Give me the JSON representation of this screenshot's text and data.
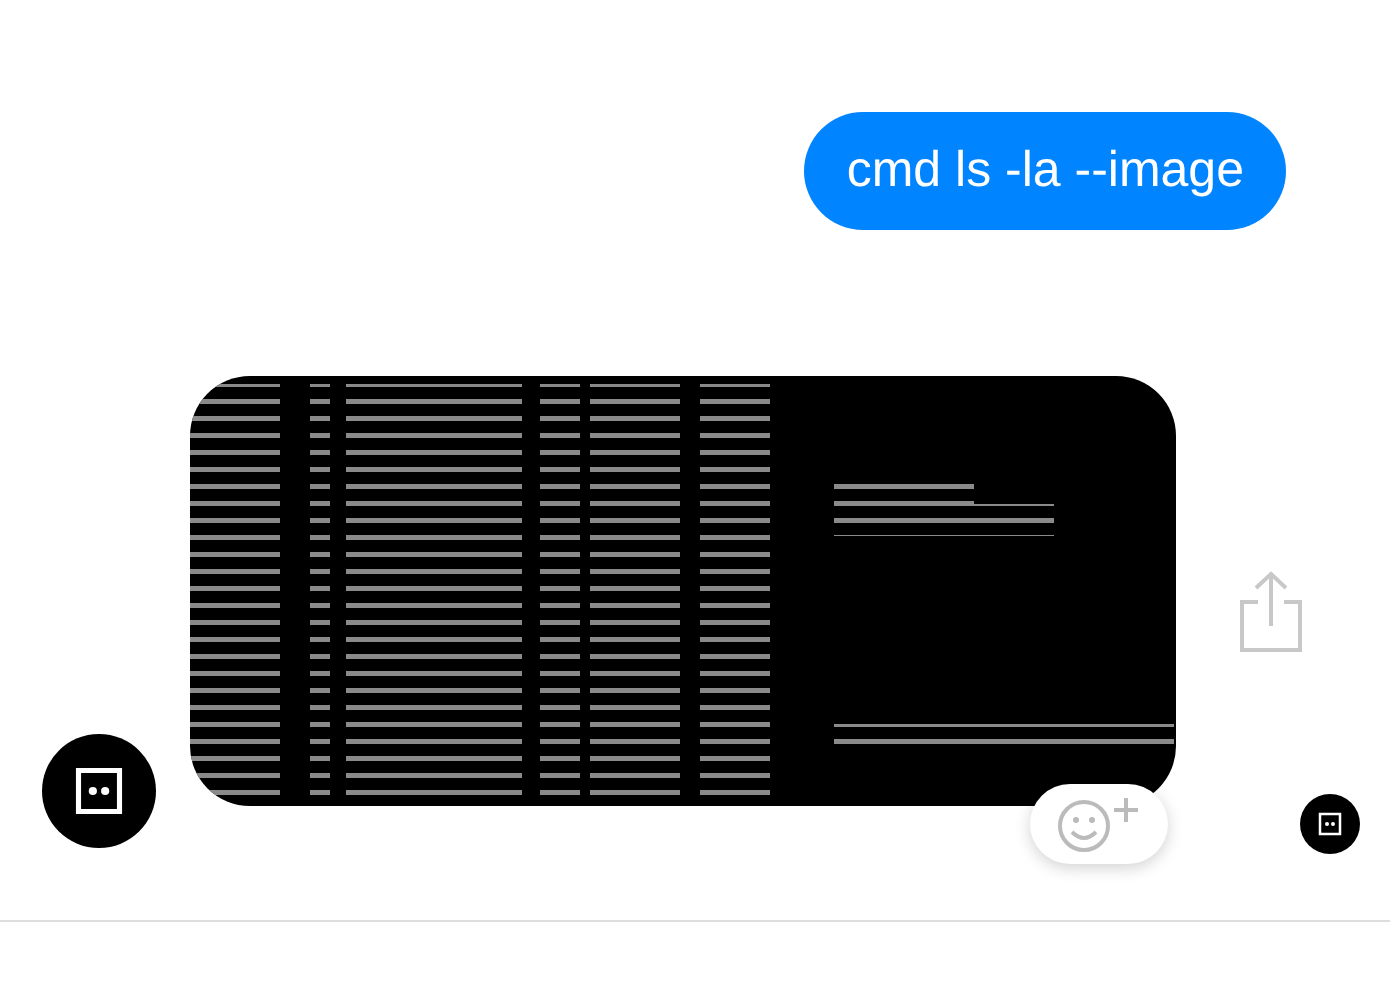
{
  "messages": [
    {
      "kind": "text",
      "outgoing": true,
      "text": "cmd ls -la --image"
    },
    {
      "kind": "picture",
      "outgoing": false
    }
  ]
}
